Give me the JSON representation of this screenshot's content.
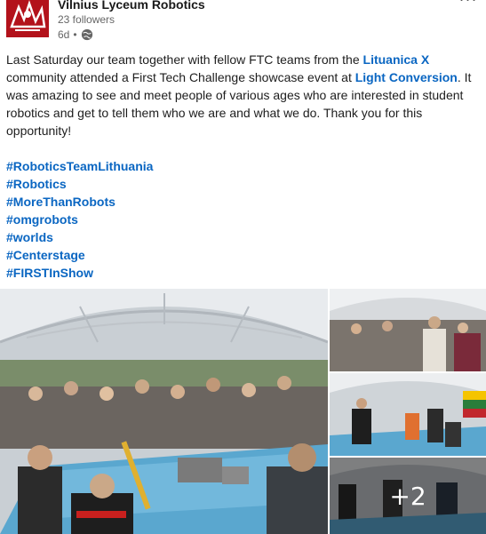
{
  "post": {
    "author": {
      "name": "Vilnius Lyceum Robotics",
      "followers": "23 followers",
      "time": "6d",
      "separator": "•",
      "visibility_icon": "globe-icon",
      "logo_icon": "vilnius-lyceum-logo",
      "logo_color": "#b3121b"
    },
    "more_icon": "more-options-icon",
    "more_label": "···",
    "text": {
      "part1": "Last Saturday our team together with fellow FTC teams from the ",
      "link1": "Lituanica X",
      "part2": " community attended a First Tech Challenge showcase event at ",
      "link2": "Light Conversion",
      "part3": ". It was amazing to see and meet people of various ages who are interested in student robotics and get to tell them who we are and what we do. Thank you for this opportunity!"
    },
    "hashtags": [
      "#RoboticsTeamLithuania",
      "#Robotics",
      "#MoreThanRobots",
      "#omgrobots",
      "#worlds",
      "#Centerstage",
      "#FIRSTInShow"
    ],
    "images": {
      "main_icon": "event-photo-robot-field",
      "side": [
        "event-photo-crowd",
        "event-photo-team",
        "event-photo-stage"
      ],
      "more_count": "+2",
      "link_color": "#0a66c2"
    }
  }
}
